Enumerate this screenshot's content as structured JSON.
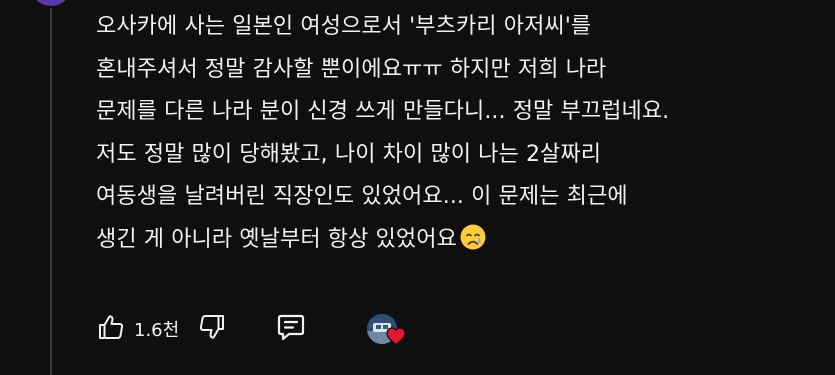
{
  "comment": {
    "lines": [
      "오사카에 사는 일본인 여성으로서 '부츠카리 아저씨'를",
      "혼내주셔서 정말 감사할 뿐이에요ㅠㅠ 하지만 저희 나라",
      "문제를 다른 나라 분이 신경 쓰게 만들다니... 정말 부끄럽네요.",
      "저도 정말 많이 당해봤고, 나이 차이 많이 나는 2살짜리",
      "여동생을 날려버린 직장인도 있었어요... 이 문제는 최근에",
      "생긴 게 아니라 옛날부터 항상 있었어요"
    ],
    "trailing_emoji": "crying-face"
  },
  "actions": {
    "like_count": "1.6천",
    "icons": {
      "like": "thumbs-up-icon",
      "dislike": "thumbs-down-icon",
      "reply": "comment-icon",
      "creator_heart": "heart-icon"
    }
  },
  "colors": {
    "background": "#0f0f0f",
    "text": "#f1f1f1",
    "heart": "#e0182d",
    "avatar": "#5b3aa8"
  }
}
